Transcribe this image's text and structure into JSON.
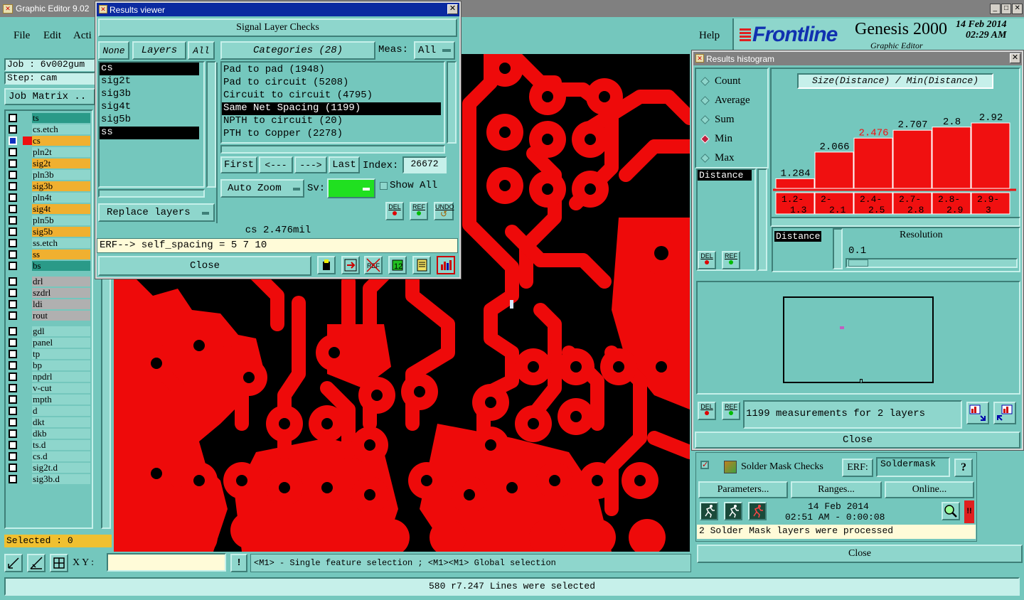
{
  "main": {
    "title": "Graphic Editor 9.02",
    "menu": [
      "File",
      "Edit",
      "Acti",
      "Help"
    ],
    "job": "Job : 6v002gum",
    "step": "Step: cam",
    "job_matrix": "Job Matrix ..",
    "brand": "Frontline",
    "product": "Genesis 2000",
    "subtitle": "Graphic Editor",
    "date": "14 Feb 2014",
    "time": "02:29 AM",
    "layers": [
      {
        "name": "ts",
        "color": "#2a9a88"
      },
      {
        "name": "cs.etch",
        "color": "#8ed6cc"
      },
      {
        "name": "cs",
        "color": "#f0b030"
      },
      {
        "name": "pln2t",
        "color": "#8ed6cc"
      },
      {
        "name": "sig2t",
        "color": "#f0b030"
      },
      {
        "name": "pln3b",
        "color": "#8ed6cc"
      },
      {
        "name": "sig3b",
        "color": "#f0b030"
      },
      {
        "name": "pln4t",
        "color": "#8ed6cc"
      },
      {
        "name": "sig4t",
        "color": "#f0b030"
      },
      {
        "name": "pln5b",
        "color": "#8ed6cc"
      },
      {
        "name": "sig5b",
        "color": "#f0b030"
      },
      {
        "name": "ss.etch",
        "color": "#8ed6cc"
      },
      {
        "name": "ss",
        "color": "#f0b030"
      },
      {
        "name": "bs",
        "color": "#2a9a88"
      },
      {
        "name": "drl",
        "color": "#b0b0b0"
      },
      {
        "name": "szdrl",
        "color": "#b0b0b0"
      },
      {
        "name": "ldi",
        "color": "#b0b0b0"
      },
      {
        "name": "rout",
        "color": "#b0b0b0"
      },
      {
        "name": "gdl",
        "color": "#8ed6cc"
      },
      {
        "name": "panel",
        "color": "#8ed6cc"
      },
      {
        "name": "tp",
        "color": "#8ed6cc"
      },
      {
        "name": "bp",
        "color": "#8ed6cc"
      },
      {
        "name": "npdrl",
        "color": "#8ed6cc"
      },
      {
        "name": "v-cut",
        "color": "#8ed6cc"
      },
      {
        "name": "mpth",
        "color": "#8ed6cc"
      },
      {
        "name": "d",
        "color": "#8ed6cc"
      },
      {
        "name": "dkt",
        "color": "#8ed6cc"
      },
      {
        "name": "dkb",
        "color": "#8ed6cc"
      },
      {
        "name": "ts.d",
        "color": "#8ed6cc"
      },
      {
        "name": "cs.d",
        "color": "#8ed6cc"
      },
      {
        "name": "sig2t.d",
        "color": "#8ed6cc"
      },
      {
        "name": "sig3b.d",
        "color": "#8ed6cc"
      }
    ],
    "selected": "Selected : 0",
    "xy_label": "X Y :",
    "xy_value": "",
    "mouse_hint": "<M1> - Single feature selection ; <M1><M1> Global selection",
    "status": "580 r7.247 Lines were selected"
  },
  "results_viewer": {
    "title": "Results viewer",
    "header": "Signal Layer Checks",
    "none_btn": "None",
    "layers_btn": "Layers",
    "all_btn": "All",
    "categories_btn": "Categories (28)",
    "meas_label": "Meas:",
    "meas_value": "All",
    "layer_list": [
      "cs",
      "sig2t",
      "sig3b",
      "sig4t",
      "sig5b",
      "ss"
    ],
    "categories": [
      "Pad to pad (1948)",
      "Pad to circuit (5208)",
      "Circuit to circuit (4795)",
      "Same Net Spacing (1199)",
      "NPTH to circuit (20)",
      "PTH to Copper (2278)"
    ],
    "first": "First",
    "prev": "<---",
    "next": "--->",
    "last": "Last",
    "index_label": "Index:",
    "index_value": "26672",
    "replace_layers": "Replace layers",
    "auto_zoom": "Auto Zoom",
    "sv_label": "Sv:",
    "show_all": "Show All",
    "del": "DEL",
    "ref": "REF",
    "undo": "UNDO",
    "value_line": "cs 2.476mil",
    "erf_line": "ERF--> self_spacing = 5 7 10",
    "close": "Close",
    "sv_color": "#20e020"
  },
  "histogram": {
    "title": "Results histogram",
    "modes": [
      "Count",
      "Average",
      "Sum",
      "Min",
      "Max"
    ],
    "selected_mode": "Min",
    "graph_title": "Size(Distance) / Min(Distance)",
    "field_list": [
      "Distance"
    ],
    "chart_data": {
      "type": "bar",
      "categories": [
        "1.2-1.3",
        "2-2.1",
        "2.4-2.5",
        "2.7-2.8",
        "2.8-2.9",
        "2.9-3"
      ],
      "values": [
        1.284,
        2.066,
        2.476,
        2.707,
        2.8,
        2.92
      ],
      "value_labels": [
        "1.284",
        "2.066",
        "2.476",
        "2.707",
        "2.8",
        "2.92"
      ],
      "highlight_index": 2,
      "bar_color": "#f01010",
      "highlight_label_color": "#f01010"
    },
    "resolution_label": "Resolution",
    "resolution_field": "Distance",
    "resolution_value": "0.1",
    "measurements": "1199 measurements for 2 layers",
    "close": "Close"
  },
  "solder_mask": {
    "label": "Solder Mask Checks",
    "erf_label": "ERF:",
    "erf_value": "Soldermask",
    "help": "?",
    "parameters": "Parameters...",
    "ranges": "Ranges...",
    "online": "Online...",
    "date": "14 Feb 2014",
    "time": "02:51 AM - 0:00:08",
    "message": "2 Solder Mask layers were processed",
    "close": "Close"
  }
}
